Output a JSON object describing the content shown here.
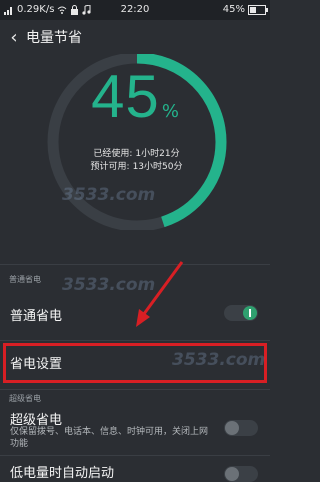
{
  "status_bar": {
    "network_speed": "0.29K/s",
    "time": "22:20",
    "battery_percent_label": "45%",
    "battery_level": 0.45,
    "icons": [
      "signal-icon",
      "wifi-icon",
      "lock-icon",
      "music-icon",
      "battery-icon"
    ]
  },
  "header": {
    "back_icon": "back-arrow-icon",
    "title": "电量节省"
  },
  "gauge": {
    "percent": "45",
    "unit": "%",
    "level": 0.45,
    "accent_color": "#24b38c",
    "used_label": "已经使用:",
    "used_value": "1小时21分",
    "remaining_label": "预计可用:",
    "remaining_value": "13小时50分"
  },
  "normal_section": {
    "label": "普通省电",
    "item_title": "普通省电",
    "toggle_on": true
  },
  "settings_item": {
    "title": "省电设置",
    "highlight_color": "#d81f24"
  },
  "super_section": {
    "label": "超级省电",
    "item_title": "超级省电",
    "item_desc": "仅保留拨号、电话本、信息、时钟可用，关闭上网功能",
    "toggle_on": false
  },
  "auto_item": {
    "title": "低电量时自动启动",
    "toggle_on": false
  },
  "watermark": {
    "text": "3533.com"
  }
}
